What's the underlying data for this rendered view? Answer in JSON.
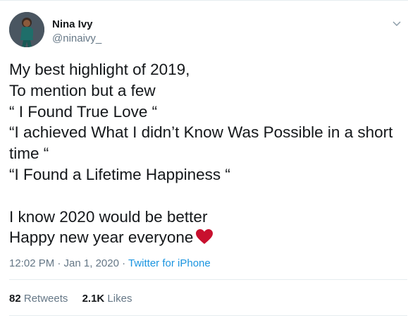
{
  "user": {
    "name": "Nina Ivy",
    "handle": "@ninaivy_"
  },
  "tweet": {
    "lines": [
      "My best highlight of 2019,",
      "To mention but a few",
      "“ I Found True Love “",
      "“I achieved What I didn’t Know Was Possible in a short",
      "time “",
      "“I Found a Lifetime Happiness “",
      "",
      "I know 2020 would be better",
      "Happy new year everyone"
    ],
    "emoji": "heart-emoji"
  },
  "meta": {
    "timestamp": "12:02 PM · Jan 1, 2020",
    "separator": " · ",
    "source": "Twitter for iPhone"
  },
  "stats": {
    "retweets_count": "82",
    "retweets_label": "Retweets",
    "likes_count": "2.1K",
    "likes_label": "Likes"
  },
  "colors": {
    "text": "#14171a",
    "secondary": "#657786",
    "link": "#1b95e0",
    "heart": "#c8102e",
    "divider": "#e6ecf0"
  },
  "icons": [
    "chevron-down-icon",
    "heart-emoji"
  ]
}
